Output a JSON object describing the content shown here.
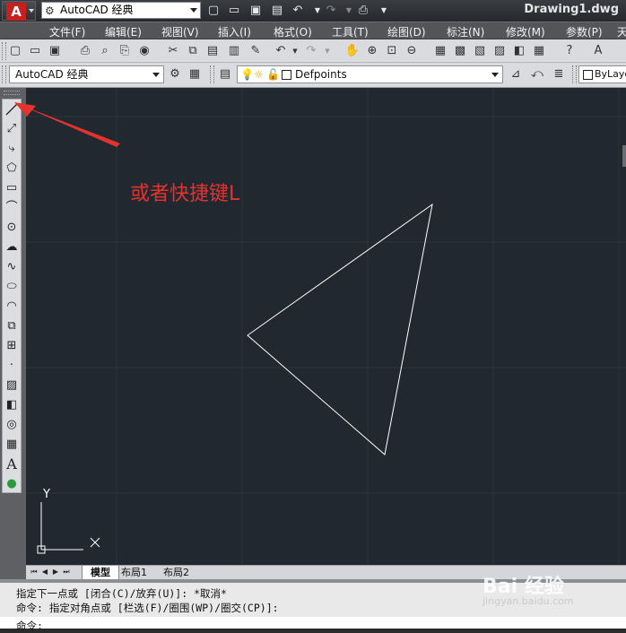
{
  "titlebar": {
    "workspace": "AutoCAD 经典",
    "document_title": "Drawing1.dwg",
    "quick_access": [
      "new-icon",
      "open-icon",
      "save-icon",
      "saveas-icon",
      "undo-icon",
      "redo-icon",
      "plot-icon",
      "customize-icon"
    ]
  },
  "menu": {
    "items": [
      {
        "label": "文件(F)"
      },
      {
        "label": "编辑(E)"
      },
      {
        "label": "视图(V)"
      },
      {
        "label": "插入(I)"
      },
      {
        "label": "格式(O)"
      },
      {
        "label": "工具(T)"
      },
      {
        "label": "绘图(D)"
      },
      {
        "label": "标注(N)"
      },
      {
        "label": "修改(M)"
      },
      {
        "label": "参数(P)"
      },
      {
        "label": "天"
      }
    ]
  },
  "toolbar2": {
    "workspace_select": "AutoCAD 经典",
    "layer_select": "Defpoints",
    "color_select": "ByLaye"
  },
  "draw_tools": [
    "line-icon",
    "construction-line-icon",
    "polyline-icon",
    "polygon-icon",
    "rectangle-icon",
    "arc-icon",
    "circle-icon",
    "revision-cloud-icon",
    "spline-icon",
    "ellipse-icon",
    "ellipse-arc-icon",
    "insert-block-icon",
    "make-block-icon",
    "point-icon",
    "hatch-icon",
    "gradient-icon",
    "region-icon",
    "table-icon",
    "mtext-icon",
    "add-selected-icon"
  ],
  "draw_text_tool": "A",
  "canvas": {
    "annotation": "或者快捷键L",
    "ucs_y": "Y",
    "ucs_x": "X",
    "colors": {
      "background": "#212830",
      "geometry": "#ffffff",
      "annotation": "#e4332f"
    }
  },
  "layout_tabs": [
    {
      "label": "模型",
      "active": true
    },
    {
      "label": "布局1",
      "active": false
    },
    {
      "label": "布局2",
      "active": false
    }
  ],
  "command": {
    "history": [
      "指定下一点或 [闭合(C)/放弃(U)]: *取消*",
      "命令: 指定对角点或 [栏选(F)/圈围(WP)/圈交(CP)]:"
    ],
    "prompt": "命令:"
  },
  "watermark": {
    "brand": "Bai 经验",
    "url": "jingyan.baidu.com"
  }
}
